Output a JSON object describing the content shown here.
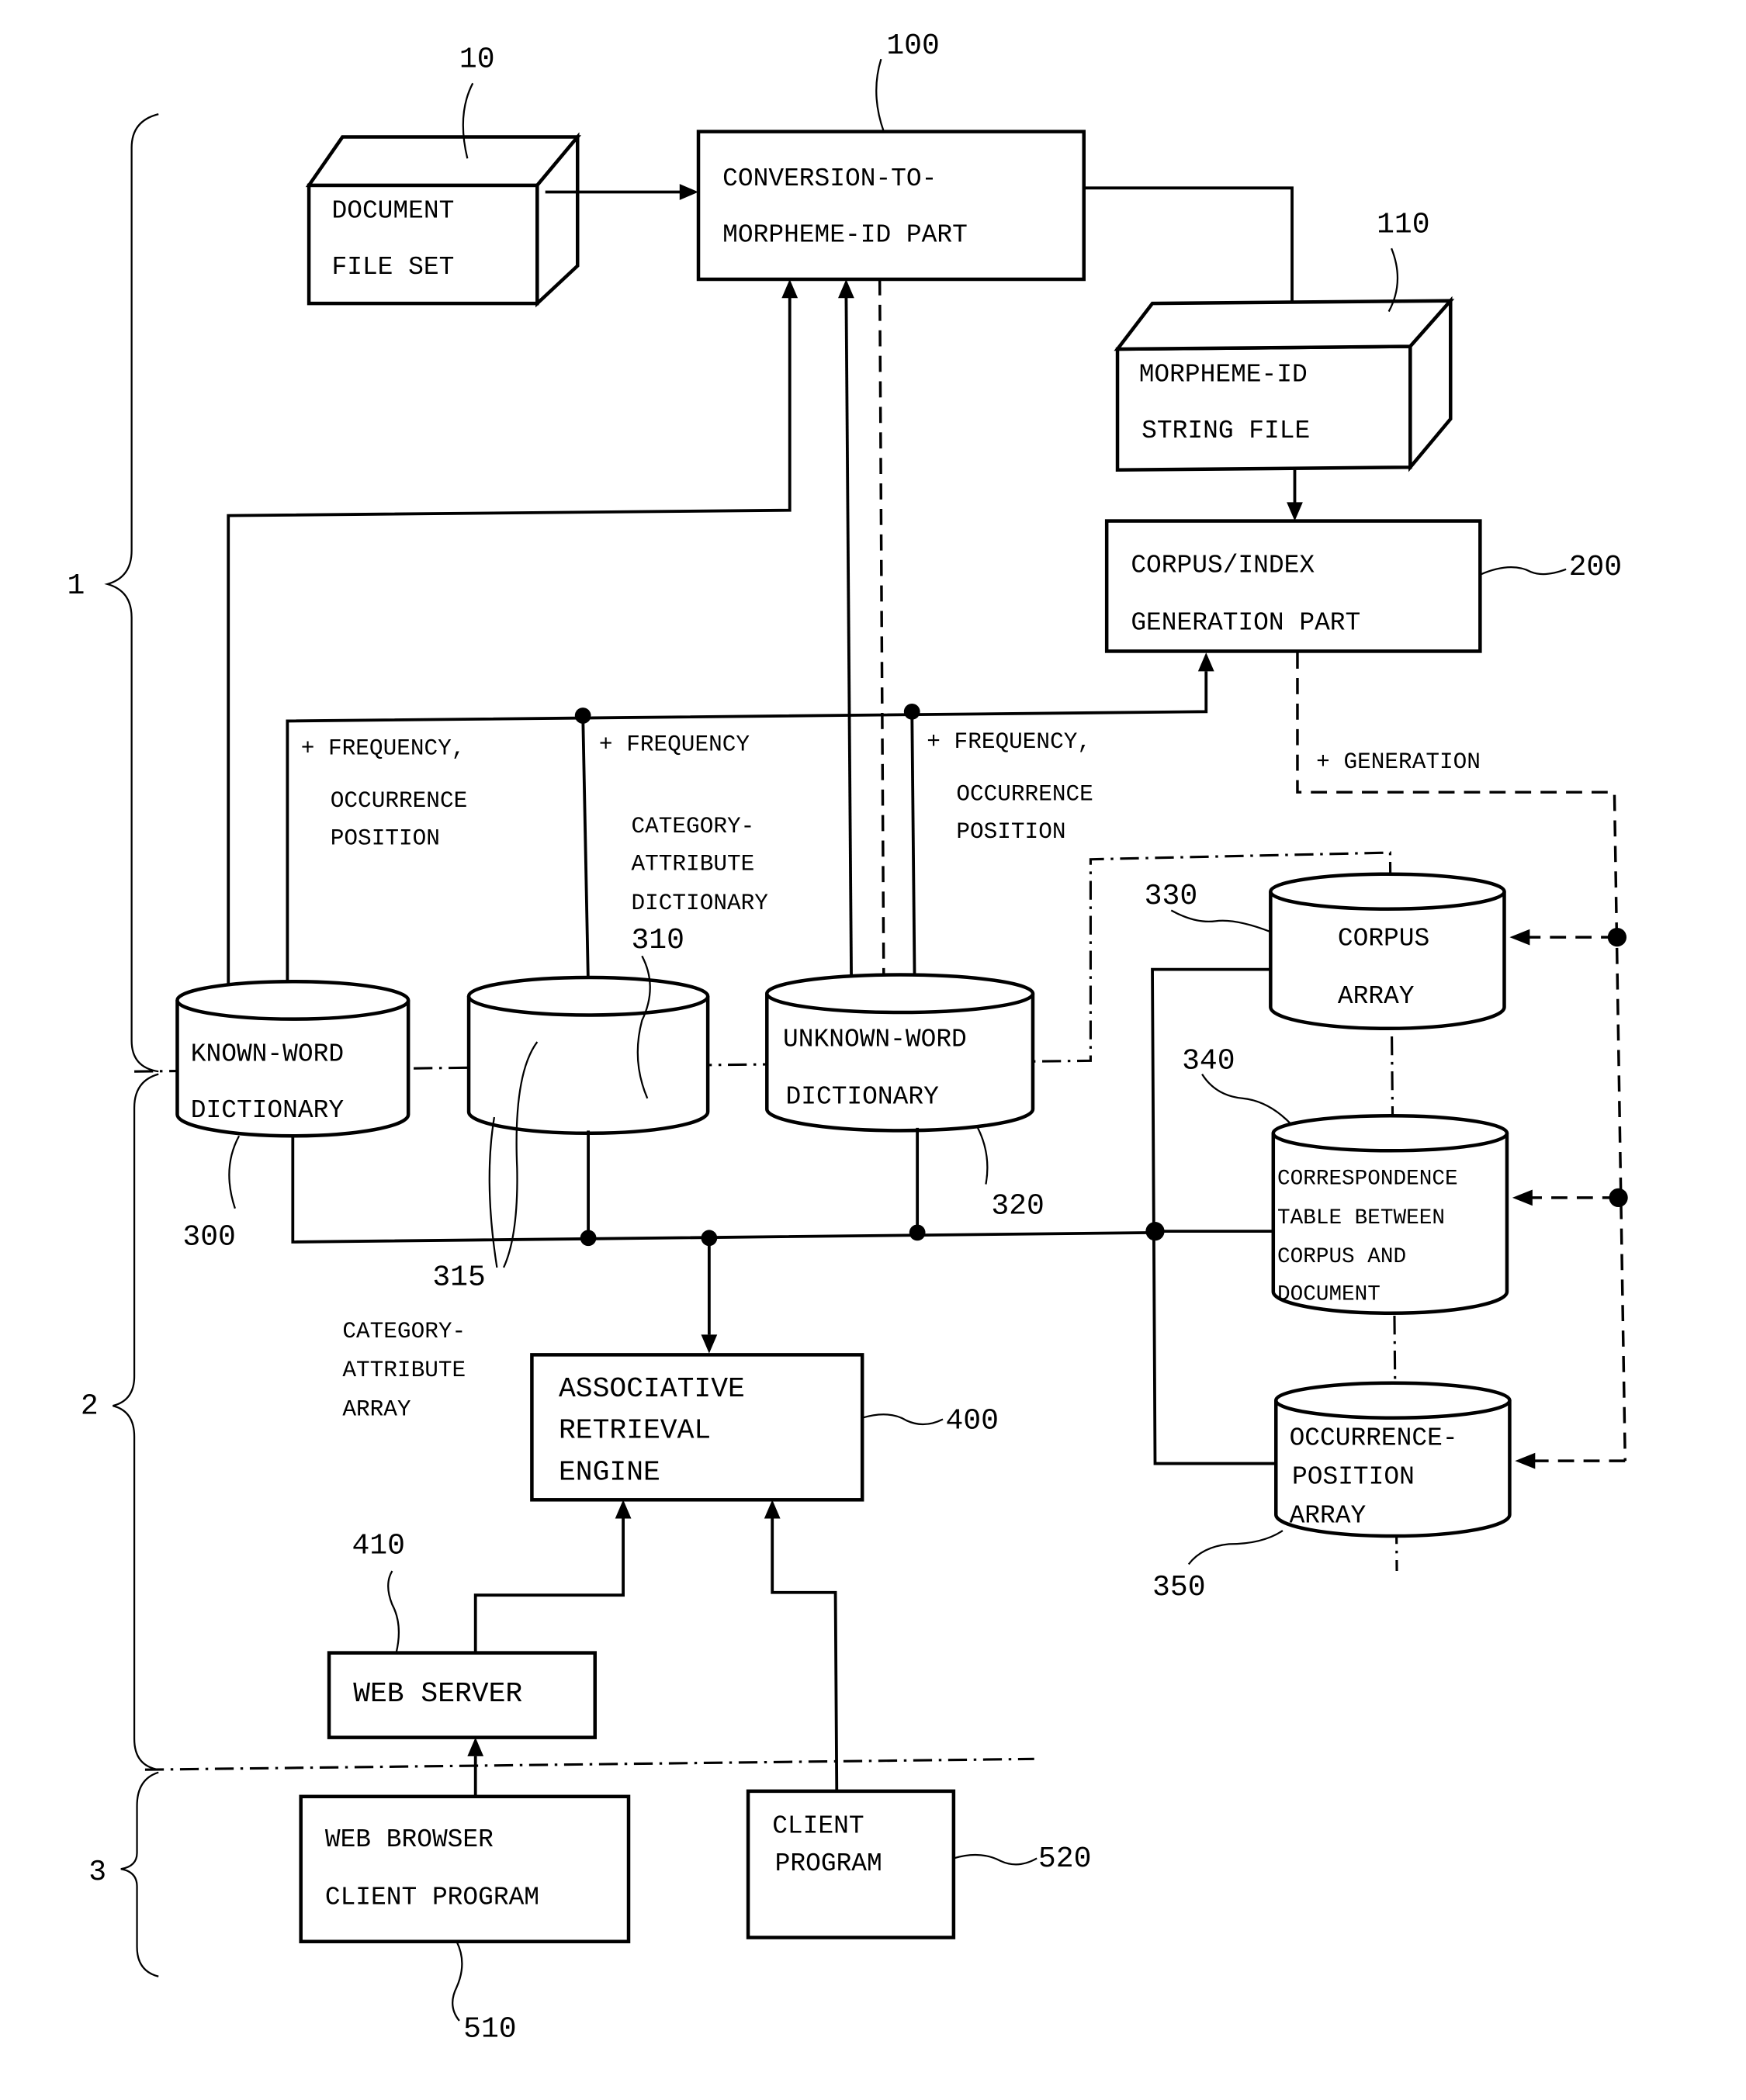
{
  "figure": {
    "sections": [
      {
        "ref": "1"
      },
      {
        "ref": "2"
      },
      {
        "ref": "3"
      }
    ],
    "blocks": {
      "document_file_set": {
        "ref": "10",
        "lines": [
          "DOCUMENT",
          "FILE  SET"
        ]
      },
      "conversion_part": {
        "ref": "100",
        "lines": [
          "CONVERSION-TO-",
          "MORPHEME-ID PART"
        ]
      },
      "morpheme_id_file": {
        "ref": "110",
        "lines": [
          "MORPHEME-ID",
          "STRING FILE"
        ]
      },
      "corpus_index_part": {
        "ref": "200",
        "lines": [
          "CORPUS/INDEX",
          "GENERATION PART"
        ]
      },
      "known_word_dictionary": {
        "ref": "300",
        "lines": [
          "KNOWN-WORD",
          "DICTIONARY"
        ]
      },
      "category_attribute_dictionary": {
        "ref": "310",
        "lines": [
          "CATEGORY-",
          "ATTRIBUTE",
          "DICTIONARY"
        ]
      },
      "category_attribute_array": {
        "ref": "315",
        "lines": [
          "CATEGORY-",
          "ATTRIBUTE",
          "ARRAY"
        ]
      },
      "unknown_word_dictionary": {
        "ref": "320",
        "lines": [
          "UNKNOWN-WORD",
          "DICTIONARY"
        ]
      },
      "corpus_array": {
        "ref": "330",
        "lines": [
          "CORPUS",
          "ARRAY"
        ]
      },
      "correspondence_table": {
        "ref": "340",
        "lines": [
          "CORRESPONDENCE",
          "TABLE BETWEEN",
          "CORPUS AND",
          "DOCUMENT"
        ]
      },
      "occurrence_position_array": {
        "ref": "350",
        "lines": [
          "OCCURRENCE-",
          "POSITION",
          "ARRAY"
        ]
      },
      "associative_engine": {
        "ref": "400",
        "lines": [
          "ASSOCIATIVE",
          "RETRIEVAL",
          "ENGINE"
        ]
      },
      "web_server": {
        "ref": "410",
        "lines": [
          "WEB SERVER"
        ]
      },
      "web_browser": {
        "ref": "510",
        "lines": [
          "WEB BROWSER",
          "CLIENT PROGRAM"
        ]
      },
      "client_program": {
        "ref": "520",
        "lines": [
          "CLIENT",
          "PROGRAM"
        ]
      }
    },
    "annotations": {
      "known_freq": [
        "+ FREQUENCY,",
        "OCCURRENCE",
        "POSITION"
      ],
      "category_freq": [
        "+ FREQUENCY"
      ],
      "unknown_freq": [
        "+ FREQUENCY,",
        "OCCURRENCE",
        "POSITION"
      ],
      "generation": [
        "+ GENERATION"
      ]
    }
  }
}
